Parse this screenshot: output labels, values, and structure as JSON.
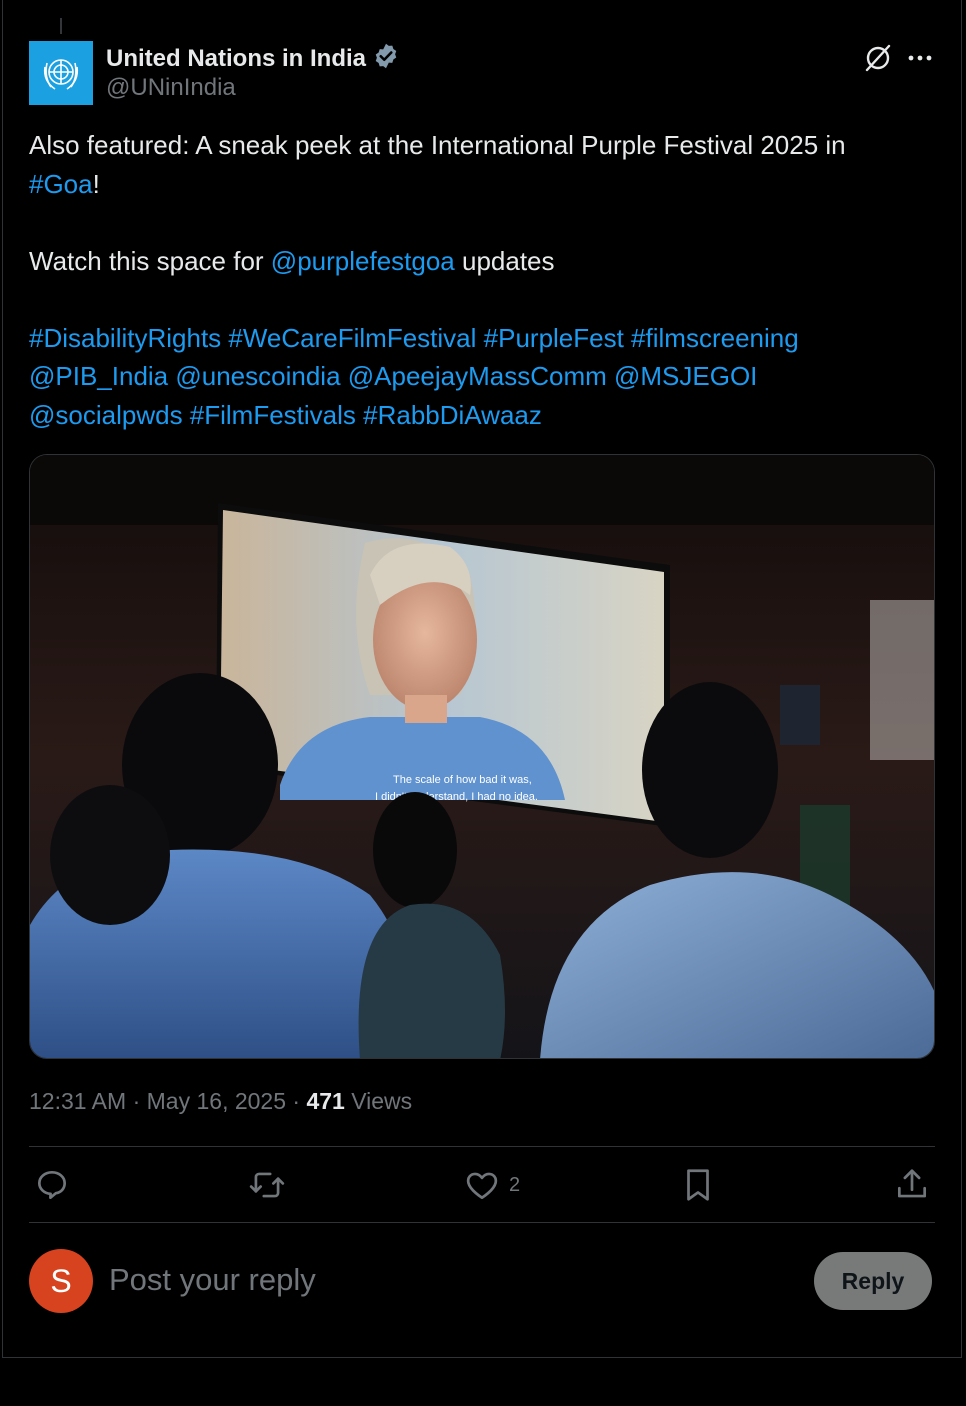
{
  "author": {
    "name": "United Nations in India",
    "handle": "@UNinIndia"
  },
  "tweet": {
    "line1": "Also featured: A sneak peek at the International Purple Festival 2025 in",
    "line2_tag": "#Goa",
    "line2_end": "!",
    "watch_prefix": "Watch this space for ",
    "watch_mention": "@purplefestgoa",
    "watch_suffix": " updates",
    "tags_line1": "#DisabilityRights #WeCareFilmFestival #PurpleFest #filmscreening",
    "tags_line2": "@PIB_India @unescoindia @ApeejayMassComm @MSJEGOI",
    "tags_line3": "@socialpwds #FilmFestivals #RabbDiAwaaz"
  },
  "media": {
    "subtitle_line1": "The scale of how bad it was,",
    "subtitle_line2": "I didn't understand, I had no idea."
  },
  "meta": {
    "time": "12:31 AM",
    "date": "May 16, 2025",
    "sep": " · ",
    "views_count": "471",
    "views_label": " Views"
  },
  "actions": {
    "like_count": "2"
  },
  "reply": {
    "avatar_letter": "S",
    "placeholder": "Post your reply",
    "button_label": "Reply"
  },
  "icons": {
    "top": [
      "grok-icon",
      "more-icon"
    ],
    "actions": [
      "reply-icon",
      "retweet-icon",
      "like-icon",
      "bookmark-icon",
      "share-icon"
    ]
  },
  "colors": {
    "link": "#1d9bf0",
    "background": "#000000",
    "secondary_text": "#71767b",
    "verified": "#829aab",
    "reply_avatar": "#d8431f"
  }
}
